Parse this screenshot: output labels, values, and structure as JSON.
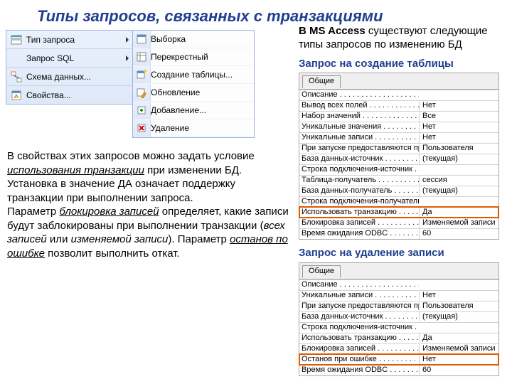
{
  "title": "Типы запросов, связанных с транзакциями",
  "menu": {
    "items": [
      {
        "label": "Тип запроса"
      },
      {
        "label": "Запрос SQL"
      },
      {
        "label": "Схема данных..."
      },
      {
        "label": "Свойства..."
      }
    ],
    "sub": [
      {
        "label": "Выборка"
      },
      {
        "label": "Перекрестный"
      },
      {
        "label": "Создание таблицы..."
      },
      {
        "label": "Обновление"
      },
      {
        "label": "Добавление..."
      },
      {
        "label": "Удаление"
      }
    ]
  },
  "intro": {
    "prefix_bold": "В MS Access",
    "rest": " существуют следующие типы запросов по изменению БД"
  },
  "section1": {
    "header": "Запрос на создание таблицы",
    "tab": "Общие",
    "rows": [
      {
        "k": "Описание . . . . . . . . . . . . . . . . . . . . .",
        "v": ""
      },
      {
        "k": "Вывод всех полей . . . . . . . . . . . . . .",
        "v": "Нет"
      },
      {
        "k": "Набор значений . . . . . . . . . . . . . . .",
        "v": "Все"
      },
      {
        "k": "Уникальные значения . . . . . . . . . .",
        "v": "Нет"
      },
      {
        "k": "Уникальные записи . . . . . . . . . . . .",
        "v": "Нет"
      },
      {
        "k": "При запуске предоставляются права .",
        "v": "Пользователя"
      },
      {
        "k": "База данных-источник . . . . . . . . . .",
        "v": "(текущая)"
      },
      {
        "k": "Строка подключения-источник . . .",
        "v": ""
      },
      {
        "k": "Таблица-получатель . . . . . . . . . . . .",
        "v": "сессия"
      },
      {
        "k": "База данных-получатель . . . . . . . .",
        "v": "(текущая)"
      },
      {
        "k": "Строка подключения-получатель .",
        "v": ""
      },
      {
        "k": "Использовать транзакцию . . . . . . .",
        "v": "Да",
        "hl": true
      },
      {
        "k": "Блокировка записей . . . . . . . . . . . .",
        "v": "Изменяемой записи"
      },
      {
        "k": "Время ожидания ODBC . . . . . . . . . .",
        "v": "60"
      }
    ]
  },
  "section2": {
    "header": "Запрос на удаление записи",
    "tab": "Общие",
    "rows": [
      {
        "k": "Описание . . . . . . . . . . . . . . . . . . . . .",
        "v": ""
      },
      {
        "k": "Уникальные записи . . . . . . . . . . . .",
        "v": "Нет"
      },
      {
        "k": "При запуске предоставляются права .",
        "v": "Пользователя"
      },
      {
        "k": "База данных-источник . . . . . . . . . .",
        "v": "(текущая)"
      },
      {
        "k": "Строка подключения-источник . . .",
        "v": ""
      },
      {
        "k": "Использовать транзакцию . . . . . . .",
        "v": "Да"
      },
      {
        "k": "Блокировка записей . . . . . . . . . . . .",
        "v": "Изменяемой записи"
      },
      {
        "k": "Останов при ошибке . . . . . . . . . . . .",
        "v": "Нет",
        "hl": true
      },
      {
        "k": "Время ожидания ODBC . . . . . . . . . .",
        "v": "60"
      }
    ]
  },
  "body": {
    "p1a": "В свойствах этих запросов можно задать условие ",
    "p1u1": "использования транзакции",
    "p1b": " при изменении БД. Установка в значение ДА означает поддержку транзакции при выполнении запроса.",
    "p2a": "Параметр ",
    "p2u1": "блокировка записей",
    "p2b": " определяет, какие записи будут заблокированы при выполнении транзакции (",
    "p2i1": "всех записей",
    "p2c": " или ",
    "p2i2": "изменяемой записи",
    "p2d": "). Параметр ",
    "p2u2": "останов по ошибке",
    "p2e": " позволит выполнить откат."
  }
}
